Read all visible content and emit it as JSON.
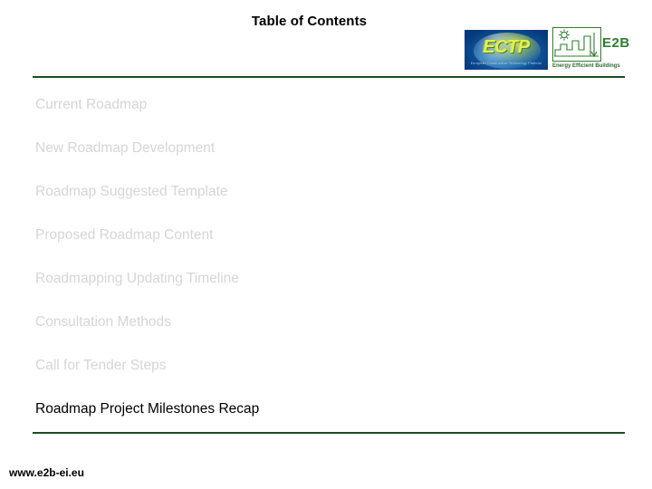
{
  "slide": {
    "title": "Table of Contents"
  },
  "logos": {
    "ectp": {
      "name": "ectp-logo",
      "wordmark": "ECTP",
      "subtext": "European Construction Technology Platform",
      "background_color": "#0a4a92",
      "wordmark_color": "#e8ef45"
    },
    "e2b": {
      "name": "e2b-logo",
      "wordmark": "E2B",
      "tagline": "Energy Efficient Buildings",
      "accent_color": "#2f7d2f"
    }
  },
  "contents": {
    "items": [
      {
        "label": "Current Roadmap",
        "active": false
      },
      {
        "label": "New Roadmap Development",
        "active": false
      },
      {
        "label": "Roadmap Suggested Template",
        "active": false
      },
      {
        "label": "Proposed Roadmap Content",
        "active": false
      },
      {
        "label": "Roadmapping Updating Timeline",
        "active": false
      },
      {
        "label": "Consultation Methods",
        "active": false
      },
      {
        "label": "Call for Tender Steps",
        "active": false
      },
      {
        "label": "Roadmap Project Milestones Recap",
        "active": true
      }
    ]
  },
  "footer": {
    "url": "www.e2b-ei.eu"
  },
  "colors": {
    "rule": "#1b4d22",
    "dimmed_text": "#d6d6d6",
    "active_text": "#000000"
  }
}
